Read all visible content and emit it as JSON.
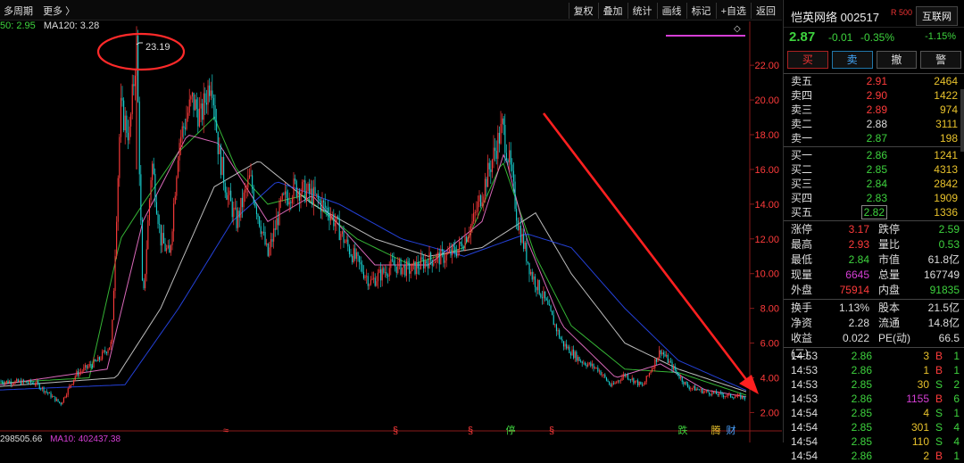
{
  "toolbar": {
    "left_items": [
      "多周期",
      "更多 〉"
    ],
    "right_items": [
      "复权",
      "叠加",
      "统计",
      "画线",
      "标记",
      "+自选",
      "返回"
    ]
  },
  "ma_top": {
    "ma60": "50: 2.95",
    "ma120": "MA120: 3.28"
  },
  "ma_bottom": {
    "vol": "298505.66",
    "ma10": "MA10: 402437.38"
  },
  "chart_data": {
    "type": "candlestick",
    "y_ticks": [
      "22.00",
      "20.00",
      "18.00",
      "16.00",
      "14.00",
      "12.00",
      "10.00",
      "8.00",
      "6.00",
      "4.00",
      "2.00"
    ],
    "ylim": [
      1.2,
      23.6
    ],
    "peak_annotation": "23.19",
    "peak_value": 23.19,
    "keypoints": [
      [
        0,
        3.8
      ],
      [
        40,
        3.7
      ],
      [
        68,
        2.5
      ],
      [
        85,
        4.2
      ],
      [
        110,
        5.0
      ],
      [
        125,
        6.0
      ],
      [
        135,
        19.5
      ],
      [
        145,
        18.0
      ],
      [
        153,
        23.19
      ],
      [
        160,
        8.0
      ],
      [
        170,
        16.5
      ],
      [
        180,
        12.0
      ],
      [
        190,
        11.0
      ],
      [
        200,
        17.5
      ],
      [
        215,
        20.0
      ],
      [
        225,
        19.0
      ],
      [
        237,
        21.5
      ],
      [
        245,
        17.0
      ],
      [
        255,
        14.5
      ],
      [
        265,
        13.0
      ],
      [
        280,
        15.5
      ],
      [
        300,
        11.0
      ],
      [
        315,
        14.0
      ],
      [
        330,
        15.0
      ],
      [
        350,
        14.5
      ],
      [
        370,
        13.5
      ],
      [
        390,
        11.5
      ],
      [
        415,
        9.5
      ],
      [
        440,
        10.5
      ],
      [
        460,
        10.2
      ],
      [
        480,
        10.8
      ],
      [
        500,
        11.0
      ],
      [
        515,
        11.5
      ],
      [
        530,
        13.0
      ],
      [
        545,
        15.5
      ],
      [
        563,
        18.5
      ],
      [
        572,
        16.0
      ],
      [
        580,
        13.0
      ],
      [
        595,
        10.0
      ],
      [
        610,
        8.5
      ],
      [
        630,
        6.0
      ],
      [
        650,
        5.0
      ],
      [
        670,
        4.5
      ],
      [
        685,
        3.5
      ],
      [
        700,
        4.2
      ],
      [
        720,
        3.5
      ],
      [
        740,
        5.6
      ],
      [
        755,
        4.5
      ],
      [
        770,
        3.5
      ],
      [
        790,
        3.2
      ],
      [
        810,
        3.0
      ],
      [
        836,
        2.87
      ]
    ],
    "ma_series": [
      {
        "color": "#3ed33e",
        "keypoints": [
          [
            0,
            3.7
          ],
          [
            100,
            4.0
          ],
          [
            135,
            12.0
          ],
          [
            160,
            14.0
          ],
          [
            200,
            17.0
          ],
          [
            240,
            19.0
          ],
          [
            265,
            16.0
          ],
          [
            300,
            14.0
          ],
          [
            340,
            14.5
          ],
          [
            400,
            12.0
          ],
          [
            460,
            10.5
          ],
          [
            520,
            11.5
          ],
          [
            563,
            16.5
          ],
          [
            600,
            11.0
          ],
          [
            640,
            7.0
          ],
          [
            700,
            4.5
          ],
          [
            760,
            4.3
          ],
          [
            836,
            3.0
          ]
        ]
      },
      {
        "color": "#ff7ad9",
        "keypoints": [
          [
            0,
            3.6
          ],
          [
            120,
            4.5
          ],
          [
            160,
            13.0
          ],
          [
            210,
            18.0
          ],
          [
            245,
            17.5
          ],
          [
            300,
            13.0
          ],
          [
            350,
            14.5
          ],
          [
            420,
            10.5
          ],
          [
            480,
            10.5
          ],
          [
            540,
            13.0
          ],
          [
            565,
            17.0
          ],
          [
            590,
            12.0
          ],
          [
            630,
            7.0
          ],
          [
            690,
            4.0
          ],
          [
            740,
            4.8
          ],
          [
            790,
            3.3
          ],
          [
            836,
            2.9
          ]
        ]
      },
      {
        "color": "#dddddd",
        "keypoints": [
          [
            0,
            3.5
          ],
          [
            130,
            4.0
          ],
          [
            180,
            8.0
          ],
          [
            240,
            15.0
          ],
          [
            290,
            16.5
          ],
          [
            350,
            14.0
          ],
          [
            420,
            12.0
          ],
          [
            480,
            11.0
          ],
          [
            540,
            11.5
          ],
          [
            600,
            13.5
          ],
          [
            640,
            10.0
          ],
          [
            700,
            6.0
          ],
          [
            760,
            4.5
          ],
          [
            836,
            3.2
          ]
        ]
      },
      {
        "color": "#2a4cff",
        "keypoints": [
          [
            0,
            3.3
          ],
          [
            140,
            3.6
          ],
          [
            200,
            8.0
          ],
          [
            260,
            13.0
          ],
          [
            310,
            15.3
          ],
          [
            380,
            14.0
          ],
          [
            450,
            12.0
          ],
          [
            520,
            11.0
          ],
          [
            590,
            12.3
          ],
          [
            640,
            11.5
          ],
          [
            700,
            8.0
          ],
          [
            760,
            5.0
          ],
          [
            836,
            3.28
          ]
        ]
      }
    ],
    "event_markers": [
      {
        "label": "≈",
        "x": 253,
        "color": "#ff3b3b"
      },
      {
        "label": "§",
        "x": 443,
        "color": "#ff3b3b"
      },
      {
        "label": "§",
        "x": 527,
        "color": "#ff3b3b"
      },
      {
        "label": "停",
        "x": 572,
        "color": "#3ed33e"
      },
      {
        "label": "§",
        "x": 618,
        "color": "#ff3b3b"
      },
      {
        "label": "跌",
        "x": 765,
        "color": "#3ed33e"
      },
      {
        "label": "腾",
        "x": 802,
        "color": "#e8c22c"
      },
      {
        "label": "财",
        "x": 819,
        "color": "#4aa3ff"
      }
    ]
  },
  "side": {
    "name": "恺英网络 002517",
    "r_tag": "R 500",
    "industry_tag": "互联网",
    "price": "2.87",
    "change": "-0.01",
    "pct": "-0.35%",
    "industry_pct": "-1.15%",
    "buttons": [
      "买",
      "卖",
      "撤",
      "警"
    ],
    "asks": [
      {
        "label": "卖五",
        "price": "2.91",
        "vol": "2464",
        "pc": "red"
      },
      {
        "label": "卖四",
        "price": "2.90",
        "vol": "1422",
        "pc": "red"
      },
      {
        "label": "卖三",
        "price": "2.89",
        "vol": "974",
        "pc": "red"
      },
      {
        "label": "卖二",
        "price": "2.88",
        "vol": "3111",
        "pc": "white"
      },
      {
        "label": "卖一",
        "price": "2.87",
        "vol": "198",
        "pc": "green"
      }
    ],
    "bids": [
      {
        "label": "买一",
        "price": "2.86",
        "vol": "1241",
        "pc": "green"
      },
      {
        "label": "买二",
        "price": "2.85",
        "vol": "4313",
        "pc": "green"
      },
      {
        "label": "买三",
        "price": "2.84",
        "vol": "2842",
        "pc": "green"
      },
      {
        "label": "买四",
        "price": "2.83",
        "vol": "1909",
        "pc": "green"
      },
      {
        "label": "买五",
        "price": "2.82",
        "vol": "1336",
        "pc": "green"
      }
    ],
    "stats1": [
      {
        "a": "涨停",
        "b": "3.17",
        "bc": "red",
        "c": "跌停",
        "d": "2.59",
        "dc": "green"
      },
      {
        "a": "最高",
        "b": "2.93",
        "bc": "red",
        "c": "量比",
        "d": "0.53",
        "dc": "green"
      },
      {
        "a": "最低",
        "b": "2.84",
        "bc": "green",
        "c": "市值",
        "d": "61.8亿",
        "dc": "white"
      },
      {
        "a": "现量",
        "b": "6645",
        "bc": "magenta",
        "c": "总量",
        "d": "167749",
        "dc": "white"
      },
      {
        "a": "外盘",
        "b": "75914",
        "bc": "red",
        "c": "内盘",
        "d": "91835",
        "dc": "green"
      }
    ],
    "stats2": [
      {
        "a": "换手",
        "b": "1.13%",
        "bc": "white",
        "c": "股本",
        "d": "21.5亿",
        "dc": "white"
      },
      {
        "a": "净资",
        "b": "2.28",
        "bc": "white",
        "c": "流通",
        "d": "14.8亿",
        "dc": "white"
      },
      {
        "a": "收益(二)",
        "b": "0.022",
        "bc": "white",
        "c": "PE(动)",
        "d": "66.5",
        "dc": "white"
      }
    ],
    "ticks": [
      {
        "t": "14:53",
        "p": "2.86",
        "v": "3",
        "vc": "yellow",
        "bs": "B",
        "bsc": "red",
        "n": "1"
      },
      {
        "t": "14:53",
        "p": "2.86",
        "v": "1",
        "vc": "yellow",
        "bs": "B",
        "bsc": "red",
        "n": "1"
      },
      {
        "t": "14:53",
        "p": "2.85",
        "v": "30",
        "vc": "yellow",
        "bs": "S",
        "bsc": "green",
        "n": "2"
      },
      {
        "t": "14:53",
        "p": "2.86",
        "v": "1155",
        "vc": "magenta",
        "bs": "B",
        "bsc": "red",
        "n": "6"
      },
      {
        "t": "14:54",
        "p": "2.85",
        "v": "4",
        "vc": "yellow",
        "bs": "S",
        "bsc": "green",
        "n": "1"
      },
      {
        "t": "14:54",
        "p": "2.85",
        "v": "301",
        "vc": "yellow",
        "bs": "S",
        "bsc": "green",
        "n": "4"
      },
      {
        "t": "14:54",
        "p": "2.85",
        "v": "110",
        "vc": "yellow",
        "bs": "S",
        "bsc": "green",
        "n": "4"
      },
      {
        "t": "14:54",
        "p": "2.86",
        "v": "2",
        "vc": "yellow",
        "bs": "B",
        "bsc": "red",
        "n": "1"
      }
    ]
  }
}
